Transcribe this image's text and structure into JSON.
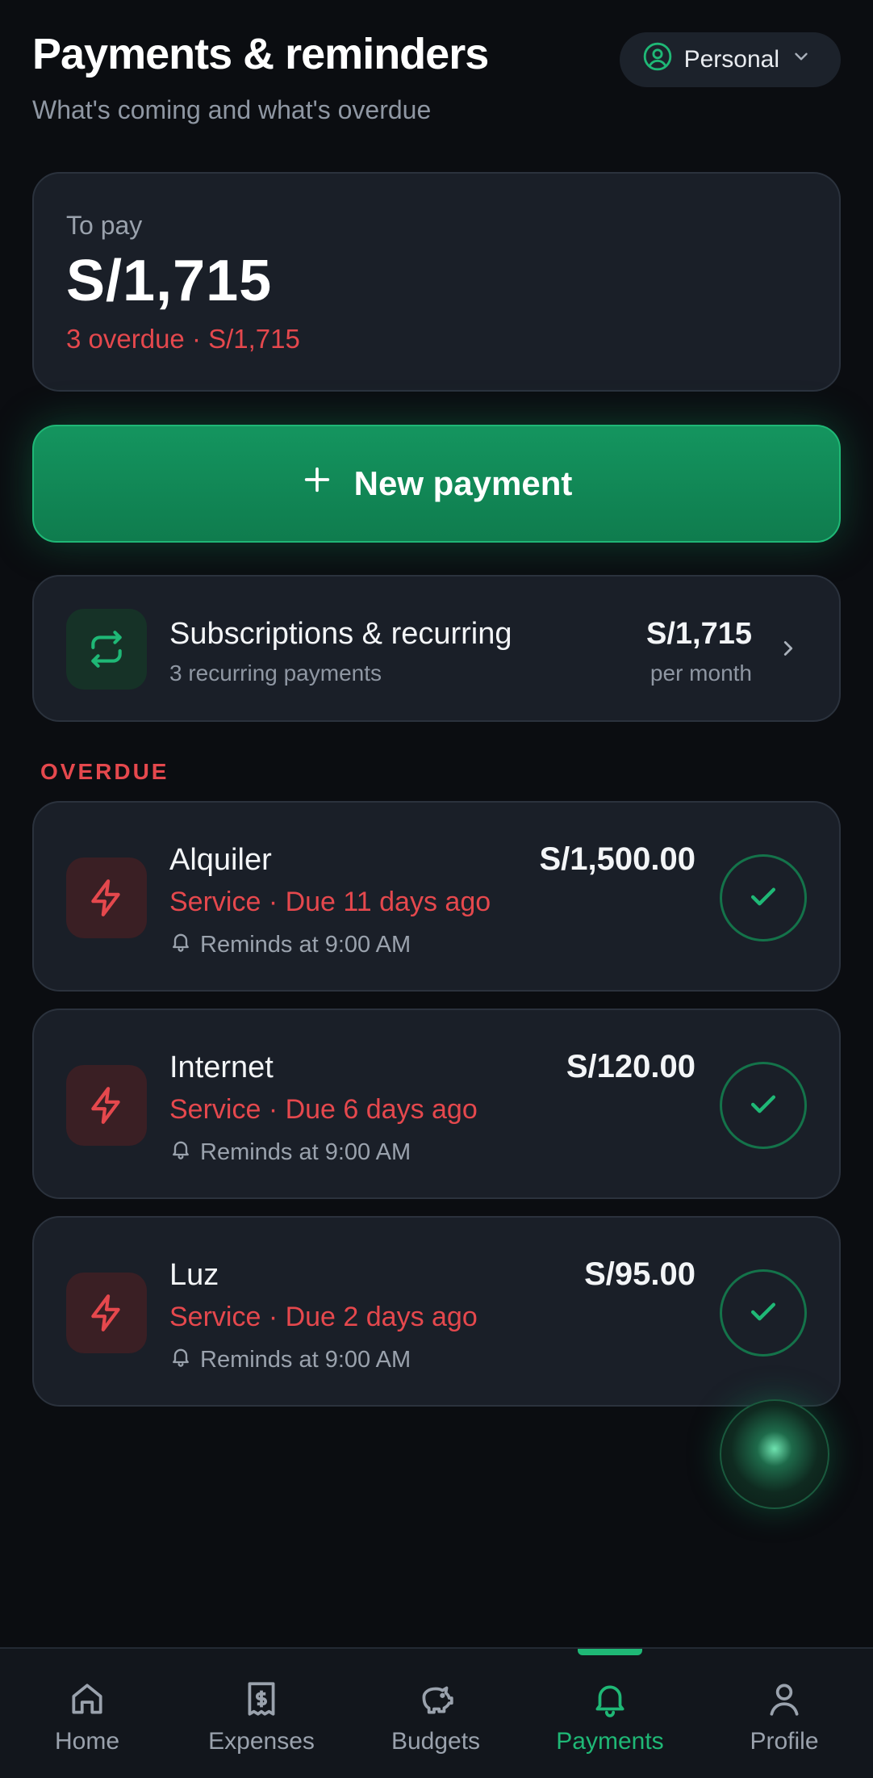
{
  "header": {
    "title": "Payments & reminders",
    "subtitle": "What's coming and what's overdue",
    "profile_label": "Personal"
  },
  "summary": {
    "label": "To pay",
    "amount": "S/1,715",
    "overdue_text": "3 overdue · S/1,715"
  },
  "new_payment": {
    "label": "New payment"
  },
  "subscriptions": {
    "title": "Subscriptions & recurring",
    "subtitle": "3 recurring payments",
    "amount": "S/1,715",
    "period": "per month"
  },
  "section": {
    "overdue_label": "OVERDUE"
  },
  "payments": [
    {
      "name": "Alquiler",
      "amount": "S/1,500.00",
      "due": "Service · Due 11 days ago",
      "remind": "Reminds at 9:00 AM"
    },
    {
      "name": "Internet",
      "amount": "S/120.00",
      "due": "Service · Due 6 days ago",
      "remind": "Reminds at 9:00 AM"
    },
    {
      "name": "Luz",
      "amount": "S/95.00",
      "due": "Service · Due 2 days ago",
      "remind": "Reminds at 9:00 AM"
    }
  ],
  "tabs": [
    {
      "label": "Home",
      "icon": "home-icon"
    },
    {
      "label": "Expenses",
      "icon": "receipt-icon"
    },
    {
      "label": "Budgets",
      "icon": "piggy-bank-icon"
    },
    {
      "label": "Payments",
      "icon": "bell-icon",
      "active": true
    },
    {
      "label": "Profile",
      "icon": "user-icon"
    }
  ],
  "colors": {
    "background": "#0b0d11",
    "card": "#1a1f28",
    "accent": "#1fb876",
    "danger": "#e5484d",
    "muted": "#8f97a3"
  }
}
